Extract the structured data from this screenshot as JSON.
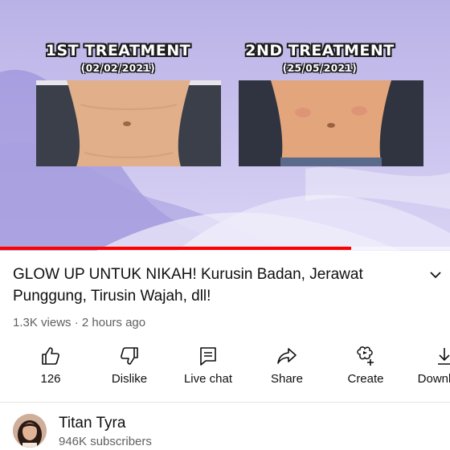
{
  "player": {
    "before_title": "1ST TREATMENT",
    "before_date": "(02/02/2021)",
    "after_title": "2ND TREATMENT",
    "after_date": "(25/05/2021)",
    "progress_fraction": 0.78,
    "progress_color": "#ff0000"
  },
  "video": {
    "title": "GLOW UP UNTUK NIKAH! Kurusin Badan, Jerawat Punggung, Tirusin Wajah, dll!",
    "views": "1.3K views",
    "separator": "·",
    "age": "2 hours ago"
  },
  "actions": [
    {
      "label": "126",
      "icon": "thumbs-up-icon"
    },
    {
      "label": "Dislike",
      "icon": "thumbs-down-icon"
    },
    {
      "label": "Live chat",
      "icon": "live-chat-icon"
    },
    {
      "label": "Share",
      "icon": "share-icon"
    },
    {
      "label": "Create",
      "icon": "create-icon"
    },
    {
      "label": "Download",
      "icon": "download-icon"
    }
  ],
  "channel": {
    "name": "Titan Tyra",
    "subscribers": "946K subscribers"
  }
}
